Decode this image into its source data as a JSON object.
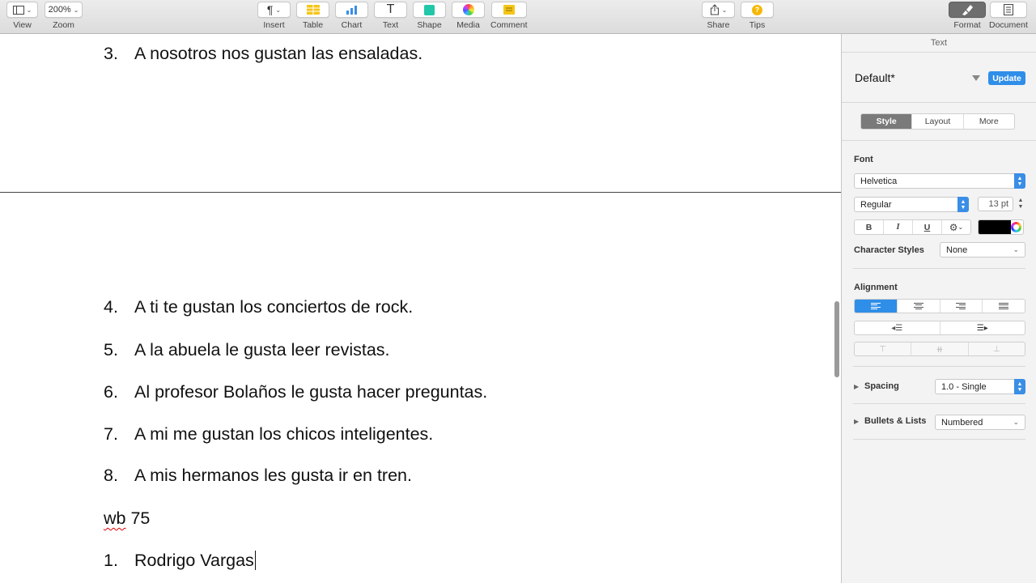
{
  "toolbar": {
    "view": {
      "label": "View"
    },
    "zoom": {
      "label": "Zoom",
      "value": "200%"
    },
    "insert": {
      "label": "Insert",
      "glyph": "¶"
    },
    "table": {
      "label": "Table",
      "icon": "table-icon",
      "color": "#f5c518"
    },
    "chart": {
      "label": "Chart",
      "icon": "chart-icon",
      "color": "#3a8ee6"
    },
    "text": {
      "label": "Text",
      "glyph": "T"
    },
    "shape": {
      "label": "Shape",
      "icon": "shape-icon",
      "color": "#22c7a9"
    },
    "media": {
      "label": "Media",
      "icon": "media-icon"
    },
    "comment": {
      "label": "Comment",
      "icon": "comment-icon",
      "color": "#f5c518"
    },
    "share": {
      "label": "Share",
      "icon": "share-icon"
    },
    "tips": {
      "label": "Tips",
      "icon": "tips-icon",
      "glyph": "?",
      "color": "#f5b800"
    },
    "format": {
      "label": "Format",
      "icon": "format-brush-icon",
      "active": true
    },
    "document": {
      "label": "Document",
      "icon": "document-icon"
    }
  },
  "document": {
    "lines": [
      {
        "num": "3.",
        "text": "A nosotros nos gustan las ensaladas."
      },
      {
        "num": "4.",
        "text": "A ti te gustan los conciertos de rock."
      },
      {
        "num": "5.",
        "text": "A la abuela le gusta leer revistas."
      },
      {
        "num": "6.",
        "text": "Al profesor Bolaños le gusta hacer preguntas."
      },
      {
        "num": "7.",
        "text": "A mi me gustan los chicos inteligentes."
      },
      {
        "num": "8.",
        "text": "A mis hermanos les gusta ir en tren."
      }
    ],
    "heading_misspelled": "wb",
    "heading_rest": " 75",
    "last_line": {
      "num": "1.",
      "text": "Rodrigo Vargas"
    }
  },
  "inspector": {
    "title": "Text",
    "paragraph_style": "Default*",
    "update_label": "Update",
    "tabs": [
      "Style",
      "Layout",
      "More"
    ],
    "active_tab": "Style",
    "font_label": "Font",
    "font_family": "Helvetica",
    "font_typeface": "Regular",
    "font_size": "13 pt",
    "bold": "B",
    "italic": "I",
    "underline": "U",
    "text_color": "#000000",
    "character_styles_label": "Character Styles",
    "character_style": "None",
    "alignment_label": "Alignment",
    "spacing_label": "Spacing",
    "spacing_value": "1.0 - Single",
    "bullets_label": "Bullets & Lists",
    "bullets_value": "Numbered"
  }
}
